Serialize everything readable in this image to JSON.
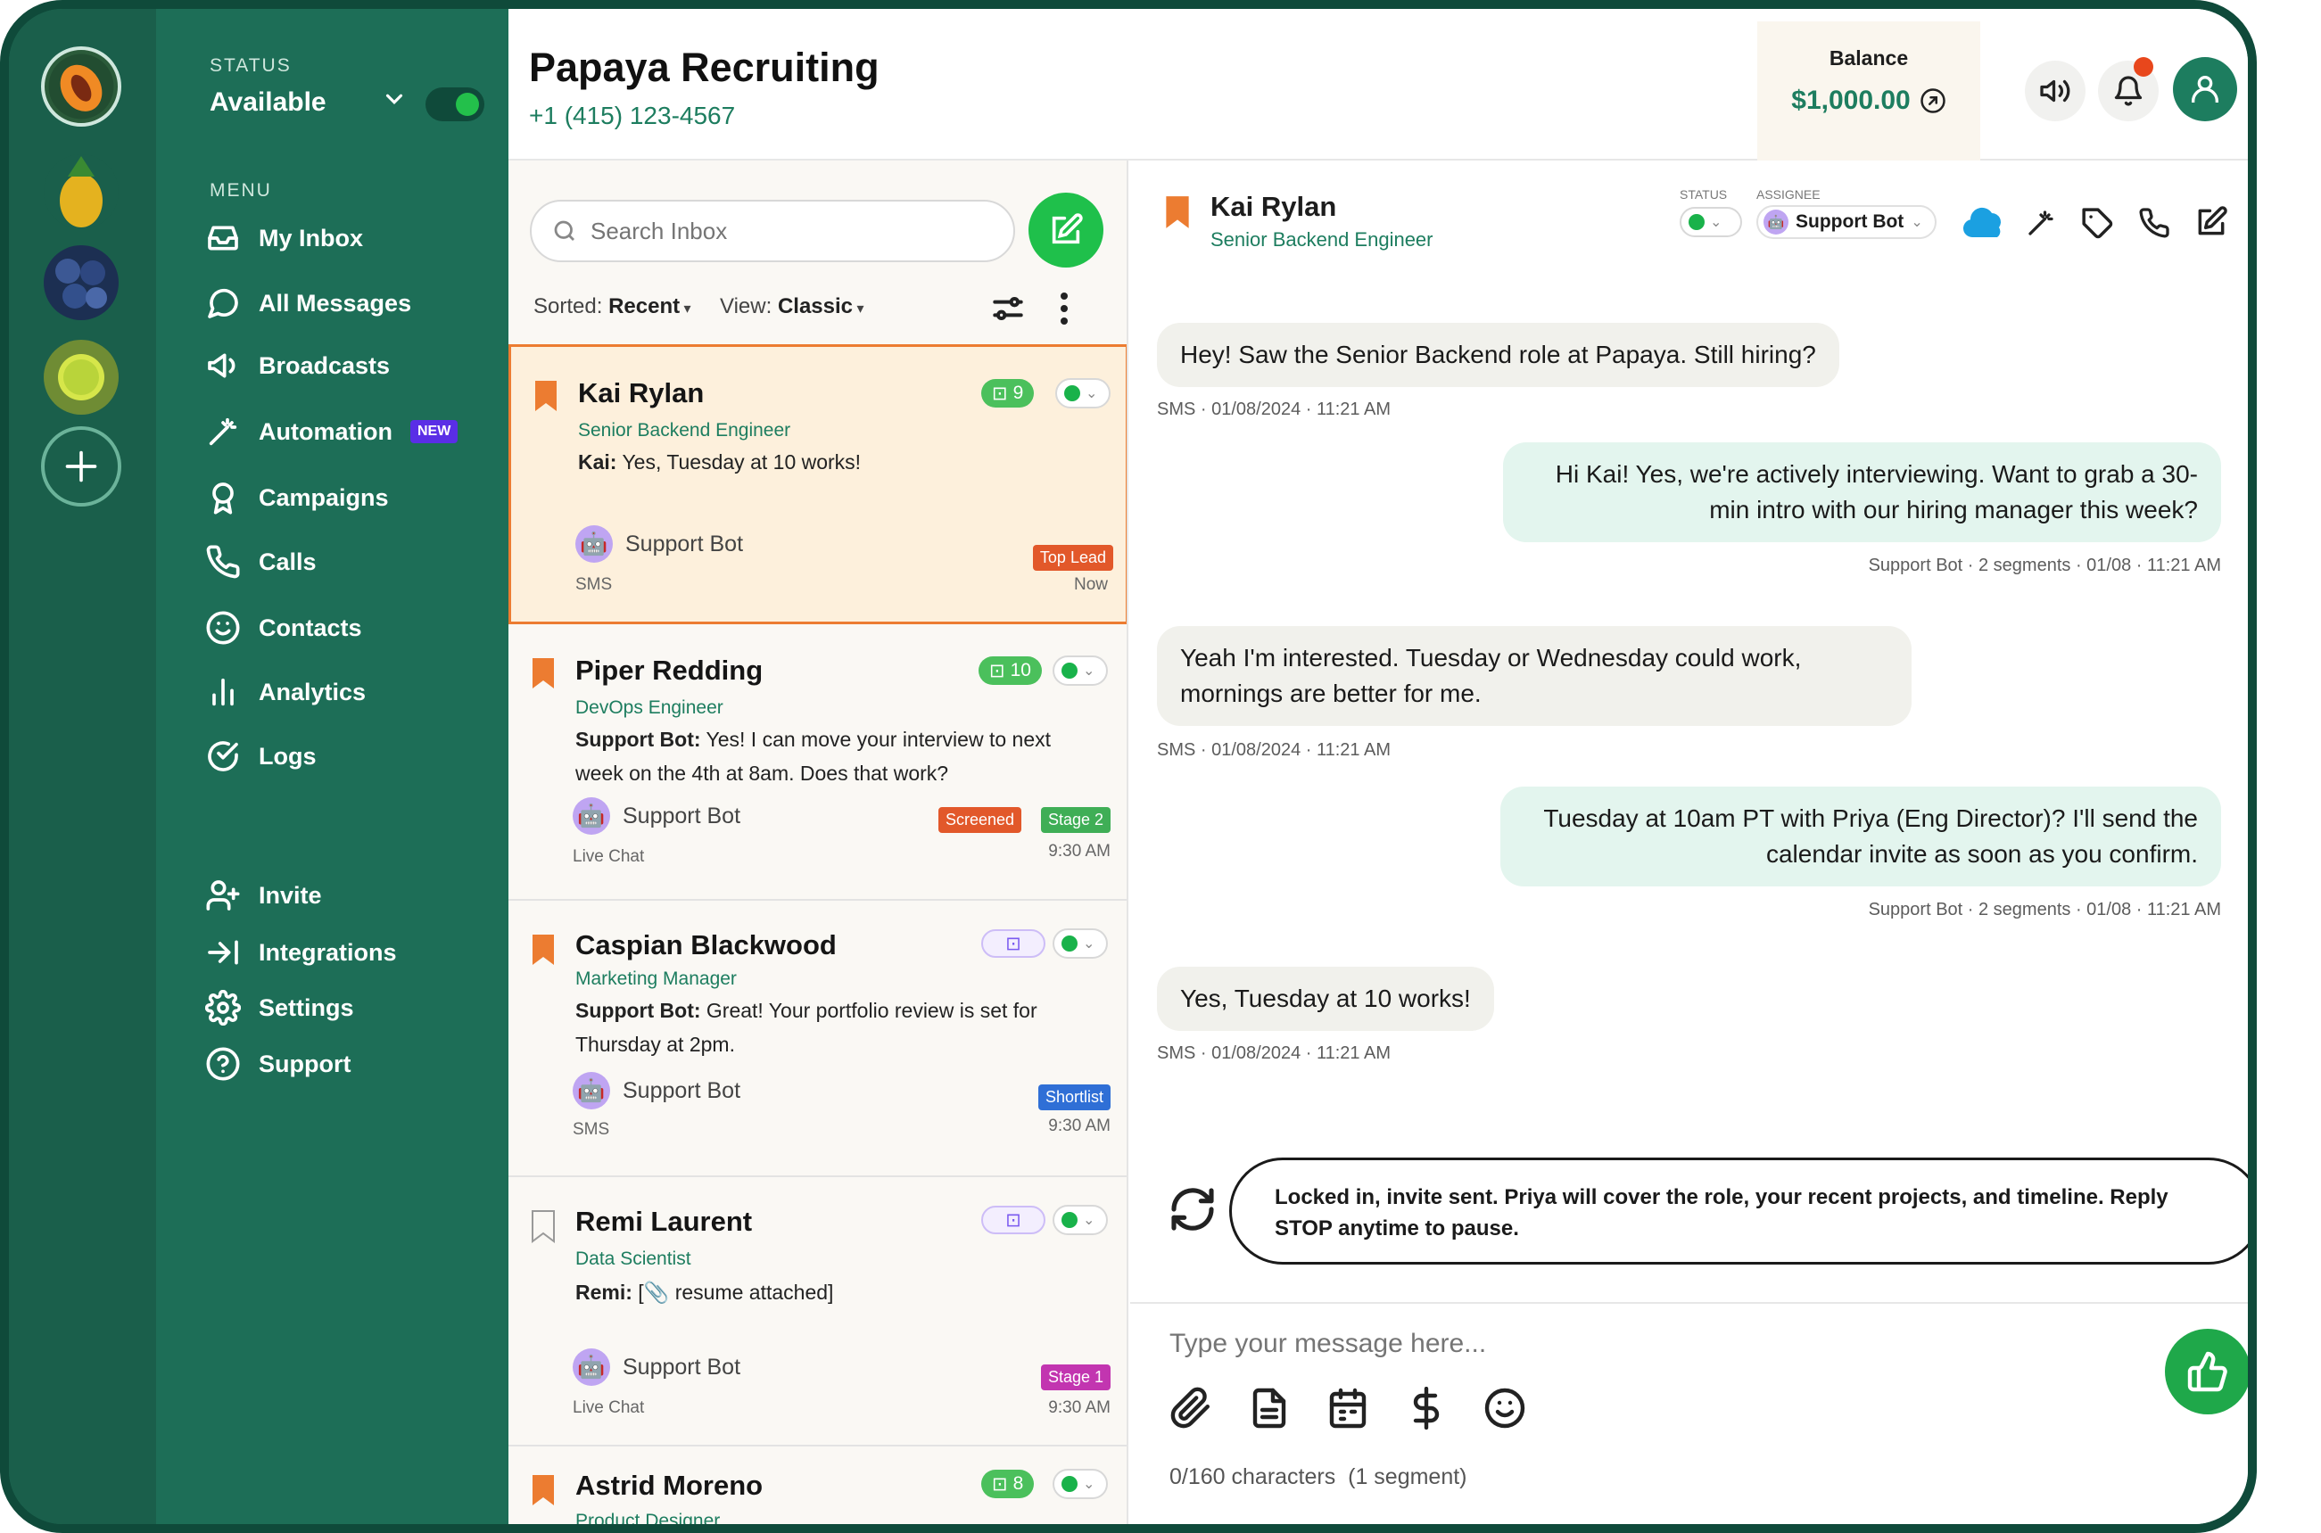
{
  "app": {
    "title": "Papaya Recruiting",
    "phone": "+1 (415) 123-4567"
  },
  "balance": {
    "label": "Balance",
    "amount": "$1,000.00"
  },
  "status": {
    "label": "STATUS",
    "value": "Available"
  },
  "menu": {
    "label": "MENU",
    "items": [
      "My Inbox",
      "All Messages",
      "Broadcasts",
      "Automation",
      "Campaigns",
      "Calls",
      "Contacts",
      "Analytics",
      "Logs"
    ],
    "new_badge": "NEW",
    "bottom": [
      "Invite",
      "Integrations",
      "Settings",
      "Support"
    ]
  },
  "inbox": {
    "search_placeholder": "Search Inbox",
    "sorted_label": "Sorted:",
    "sorted_value": "Recent",
    "view_label": "View:",
    "view_value": "Classic"
  },
  "conversations": [
    {
      "name": "Kai Rylan",
      "role": "Senior Backend Engineer",
      "sender": "Kai:",
      "message": "Yes, Tuesday at 10 works!",
      "agent": "Support Bot",
      "channel": "SMS",
      "time": "Now",
      "count": "9",
      "tags": [
        {
          "label": "Top Lead",
          "color": "#e2582a"
        }
      ]
    },
    {
      "name": "Piper Redding",
      "role": "DevOps Engineer",
      "sender": "Support Bot:",
      "message": "Yes! I can move your interview to next week on the 4th at 8am. Does that work?",
      "agent": "Support Bot",
      "channel": "Live Chat",
      "time": "9:30 AM",
      "count": "10",
      "tags": [
        {
          "label": "Screened",
          "color": "#e2582a"
        },
        {
          "label": "Stage 2",
          "color": "#3fae56"
        }
      ]
    },
    {
      "name": "Caspian Blackwood",
      "role": "Marketing Manager",
      "sender": "Support Bot:",
      "message": "Great! Your portfolio review is set for Thursday at 2pm.",
      "agent": "Support Bot",
      "channel": "SMS",
      "time": "9:30 AM",
      "count": "",
      "tags": [
        {
          "label": "Shortlist",
          "color": "#2f6fd6"
        }
      ]
    },
    {
      "name": "Remi Laurent",
      "role": "Data Scientist",
      "sender": "Remi:",
      "message": "[📎 resume attached]",
      "agent": "Support Bot",
      "channel": "Live Chat",
      "time": "9:30 AM",
      "count": "",
      "tags": [
        {
          "label": "Stage 1",
          "color": "#c235b0"
        }
      ]
    },
    {
      "name": "Astrid Moreno",
      "role": "Product Designer",
      "sender": "",
      "message": "",
      "agent": "",
      "channel": "",
      "time": "",
      "count": "8",
      "tags": []
    }
  ],
  "chat": {
    "name": "Kai Rylan",
    "role": "Senior Backend Engineer",
    "status_label": "STATUS",
    "assignee_label": "ASSIGNEE",
    "assignee": "Support Bot",
    "messages": [
      {
        "dir": "in",
        "text": "Hey! Saw the Senior Backend role at Papaya. Still hiring?",
        "meta": "SMS · 01/08/2024 · 11:21 AM"
      },
      {
        "dir": "out",
        "text": "Hi Kai! Yes, we're actively interviewing. Want to grab a 30-min intro with our hiring manager this week?",
        "meta": "Support Bot · 2 segments · 01/08 · 11:21 AM"
      },
      {
        "dir": "in",
        "text": "Yeah I'm interested. Tuesday or Wednesday could work, mornings are better for me.",
        "meta": "SMS · 01/08/2024 · 11:21 AM"
      },
      {
        "dir": "out",
        "text": "Tuesday at 10am PT with Priya (Eng Director)? I'll send the calendar invite as soon as you confirm.",
        "meta": "Support Bot · 2 segments · 01/08 · 11:21 AM"
      },
      {
        "dir": "in",
        "text": "Yes, Tuesday at 10 works!",
        "meta": "SMS · 01/08/2024 · 11:21 AM"
      }
    ],
    "suggestion": "Locked in, invite sent. Priya will cover the role, your recent projects, and timeline. Reply STOP anytime to pause.",
    "composer_placeholder": "Type your message here...",
    "char_count": "0/160 characters",
    "segments": "(1 segment)"
  },
  "colors": {
    "brand": "#1d6e57",
    "accent": "#19b24a",
    "selected_border": "#ec7c31",
    "selected_bg": "#fdf0dc",
    "balance": "#1d7d5f",
    "notification": "#e8471c"
  }
}
